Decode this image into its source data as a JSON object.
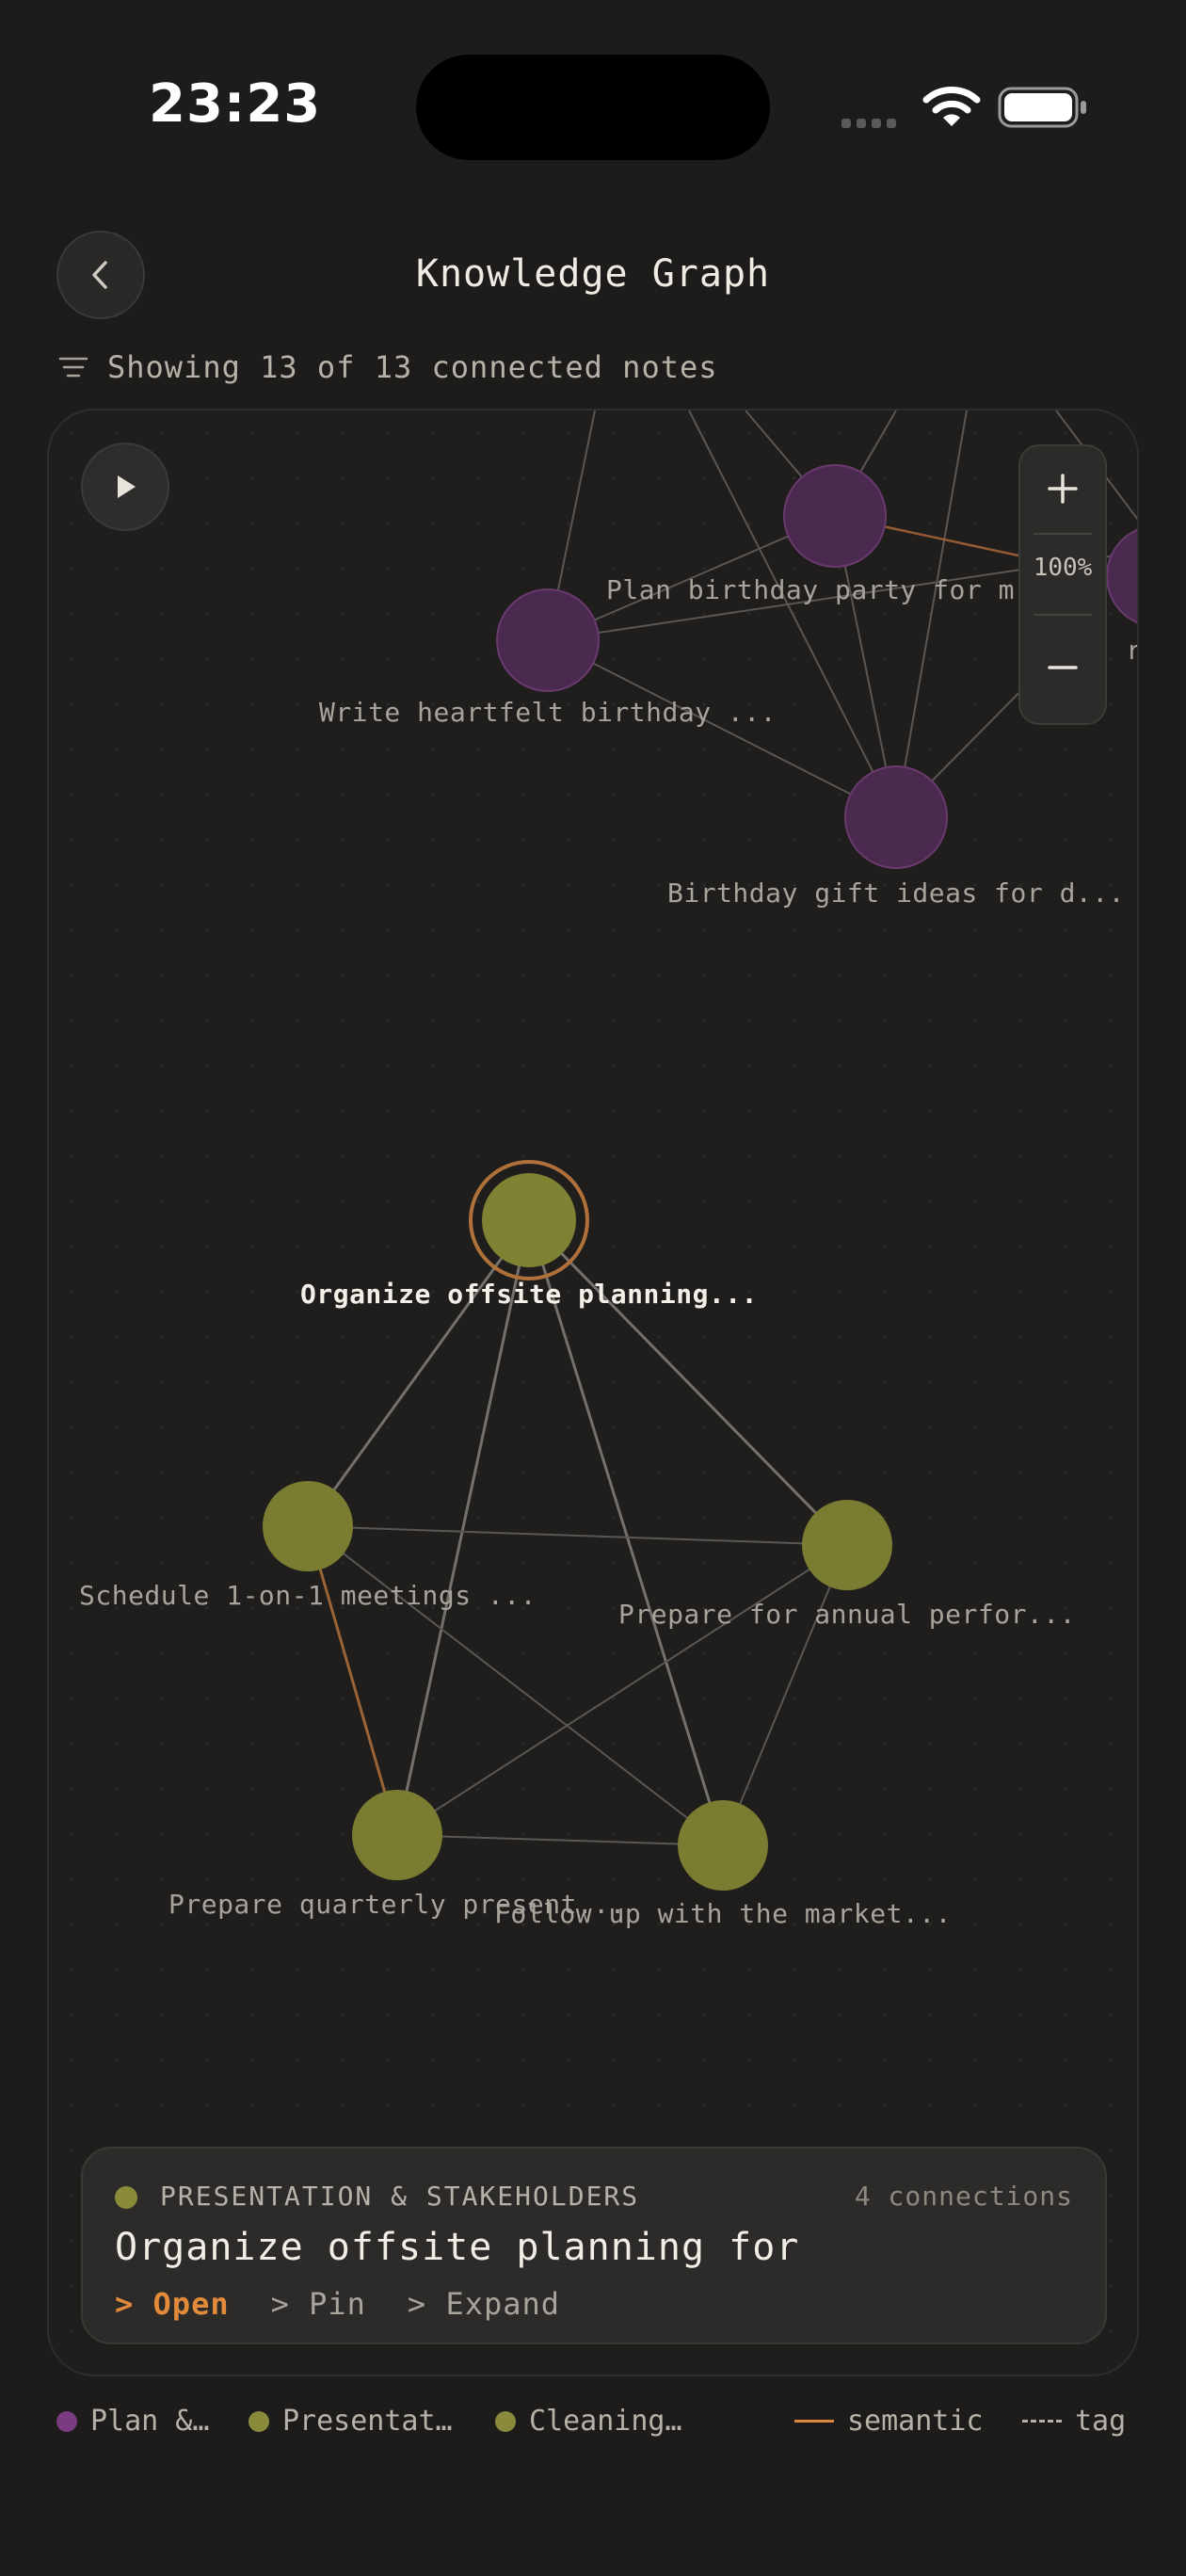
{
  "status_bar": {
    "time": "23:23"
  },
  "header": {
    "title": "Knowledge Graph"
  },
  "filter": {
    "text": "Showing 13 of 13 connected notes"
  },
  "zoom": {
    "level": "100%"
  },
  "colors": {
    "plan_cluster": "#6a3a6e",
    "presentation_cluster": "#7f8133",
    "cleaning_cluster": "#7f8133",
    "semantic_edge": "#d98a3c",
    "accent": "#e08a3a"
  },
  "nodes": [
    {
      "id": "plan-birthday",
      "label": "Plan birthday party for m...",
      "cluster": "plan"
    },
    {
      "id": "write-birthday",
      "label": "Write heartfelt birthday ...",
      "cluster": "plan"
    },
    {
      "id": "organ",
      "label": "Organ   rp",
      "cluster": "plan"
    },
    {
      "id": "gift-ideas",
      "label": "Birthday gift ideas for d...",
      "cluster": "plan"
    },
    {
      "id": "organize-offsite",
      "label": "Organize offsite planning...",
      "cluster": "presentation",
      "selected": true
    },
    {
      "id": "schedule-1on1",
      "label": "Schedule 1-on-1 meetings ...",
      "cluster": "presentation"
    },
    {
      "id": "annual-perf",
      "label": "Prepare for annual perfor...",
      "cluster": "presentation"
    },
    {
      "id": "quarterly",
      "label": "Prepare quarterly present...",
      "cluster": "presentation"
    },
    {
      "id": "follow-up",
      "label": "Follow up with the market...",
      "cluster": "presentation"
    }
  ],
  "selected_card": {
    "category": "PRESENTATION & STAKEHOLDERS",
    "connections": "4 connections",
    "title": "Organize offsite planning for",
    "actions": [
      "> Open",
      "> Pin",
      "> Expand"
    ]
  },
  "legend": {
    "items": [
      {
        "label": "Plan &…",
        "color": "#7a3b80"
      },
      {
        "label": "Presentat…",
        "color": "#8a8b3a"
      },
      {
        "label": "Cleaning…",
        "color": "#8a8b3a"
      }
    ],
    "semantic_label": "semantic",
    "tag_label": "tag"
  }
}
